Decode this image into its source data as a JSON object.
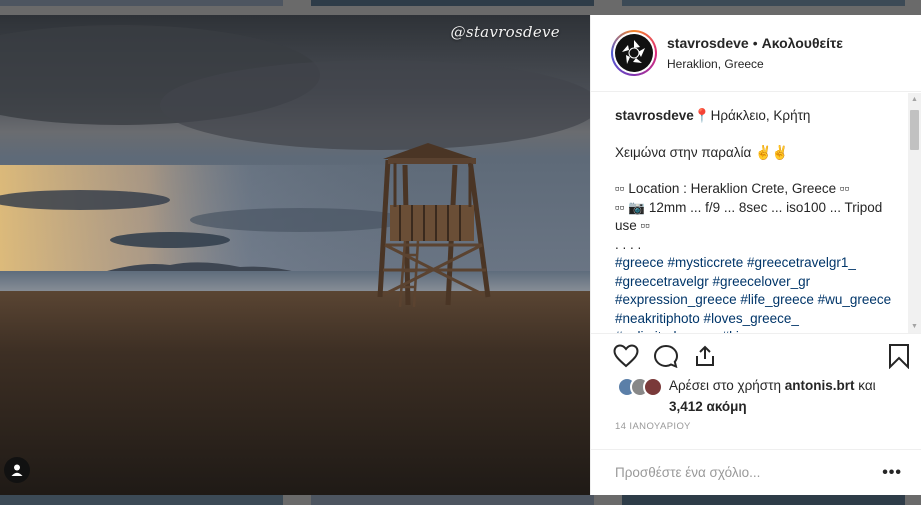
{
  "photo": {
    "watermark": "@stavrosdeve"
  },
  "header": {
    "username": "stavrosdeve",
    "separator": "•",
    "follow_status": "Ακολουθείτε",
    "location": "Heraklion, Greece"
  },
  "caption": {
    "username": "stavrosdeve",
    "title": "📍Ηράκλειο, Κρήτη",
    "divider": "﹋﹋﹋﹋﹋﹋﹋﹋﹋﹋﹋﹋﹋﹋﹋﹋﹋﹋﹋﹋﹋﹋",
    "subtitle": "Χειμώνα στην παραλία ✌✌",
    "location_line": "▫▫ Location : Heraklion Crete, Greece ▫▫",
    "settings_line": "▫▫ 📷 12mm ... f/9 ... 8sec ... iso100 ... Tripod use ▫▫",
    "dots": ". . . .",
    "hashtags": "#greece #mysticcrete #greecetravelgr1_ #greecetravelgr #greecelover_gr #expression_greece #life_greece #wu_greece #neakritiphoto #loves_greece_ #unlimitedgreece #kings_greece"
  },
  "likes": {
    "prefix": "Αρέσει στο χρήστη ",
    "user": "antonis.brt",
    "middle": " και ",
    "count": "3,412 ακόμη"
  },
  "date": "14 ΙΑΝΟΥΑΡΙΟΥ",
  "comment_input": {
    "placeholder": "Προσθέστε ένα σχόλιο..."
  },
  "more_label": "•••"
}
